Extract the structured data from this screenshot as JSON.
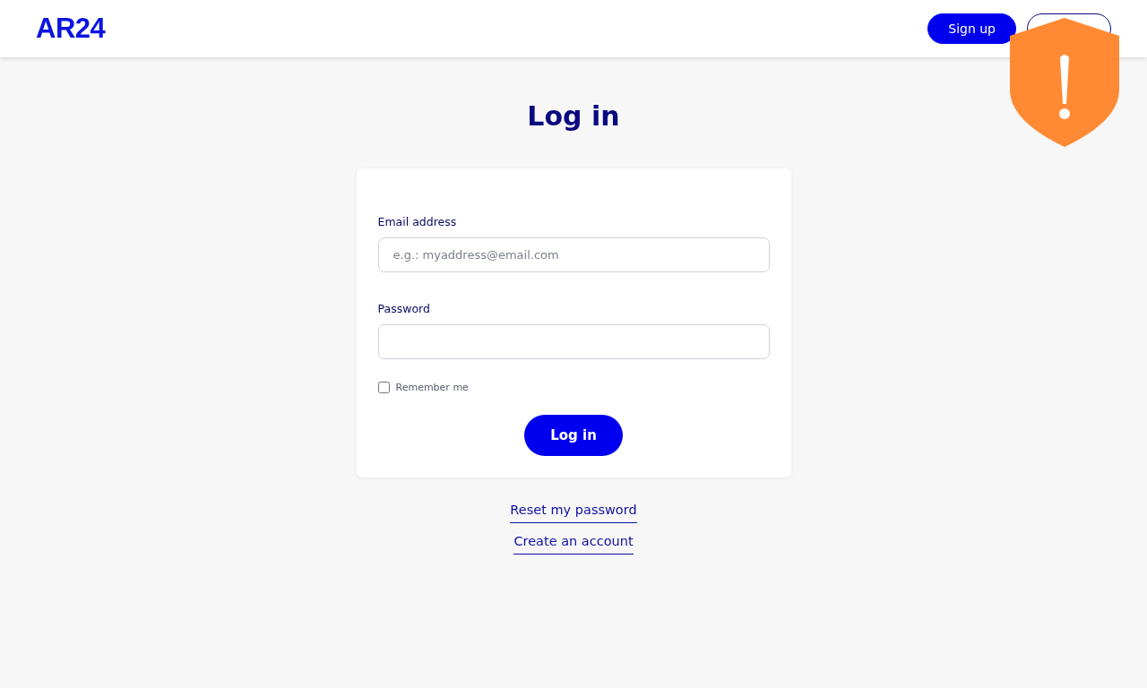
{
  "header": {
    "logo": "AR24",
    "buttons": [
      {
        "kind": "filled",
        "label": "Sign up"
      },
      {
        "kind": "outline"
      }
    ]
  },
  "alert_badge": {
    "kind": "shield-warning"
  },
  "title": "Log in",
  "form": {
    "fields": [
      {
        "label": "Email address",
        "placeholder": "e.g.: myaddress@email.com"
      },
      {
        "label": "Password"
      }
    ],
    "remember": {
      "label": "Remember me",
      "checked": false
    },
    "submit": "Log in"
  },
  "links": [
    "Reset my password",
    "Create an account"
  ]
}
